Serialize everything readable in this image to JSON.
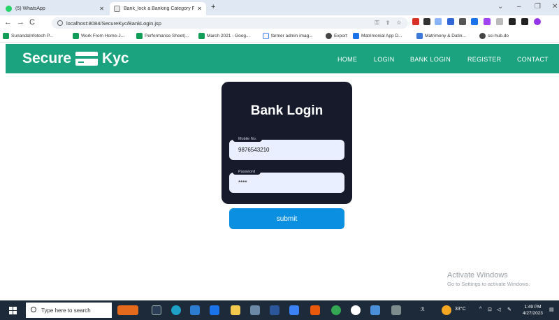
{
  "browser": {
    "tabs": [
      {
        "title": "(5) WhatsApp",
        "active": false
      },
      {
        "title": "Bank_lock a Banking Category Fi",
        "active": true
      }
    ],
    "address": "localhost:8084/SecureKyc/BankLogin.jsp",
    "bookmarks": [
      "SunandaInfotech P...",
      "Work From Home-J...",
      "Performance Sheet(...",
      "March 2021 - Goog...",
      "farmer admin imag...",
      "Export",
      "Matrimonial App D...",
      "Matrimony & Datin...",
      "sci-hub.do"
    ]
  },
  "site": {
    "brand_left": "Secure",
    "brand_right": "Kyc",
    "menu": [
      "HOME",
      "LOGIN",
      "BANK LOGIN",
      "REGISTER",
      "CONTACT"
    ],
    "color": "#1aa37e"
  },
  "login": {
    "title": "Bank Login",
    "mobile_label": "Mobile No.",
    "mobile_value": "9876543210",
    "password_label": "Password",
    "password_value": "****",
    "submit_label": "submit"
  },
  "watermark": {
    "line1": "Activate Windows",
    "line2": "Go to Settings to activate Windows."
  },
  "taskbar": {
    "search_placeholder": "Type here to search",
    "weather": "33°C",
    "time": "1:49 PM",
    "date": "4/27/2023"
  }
}
